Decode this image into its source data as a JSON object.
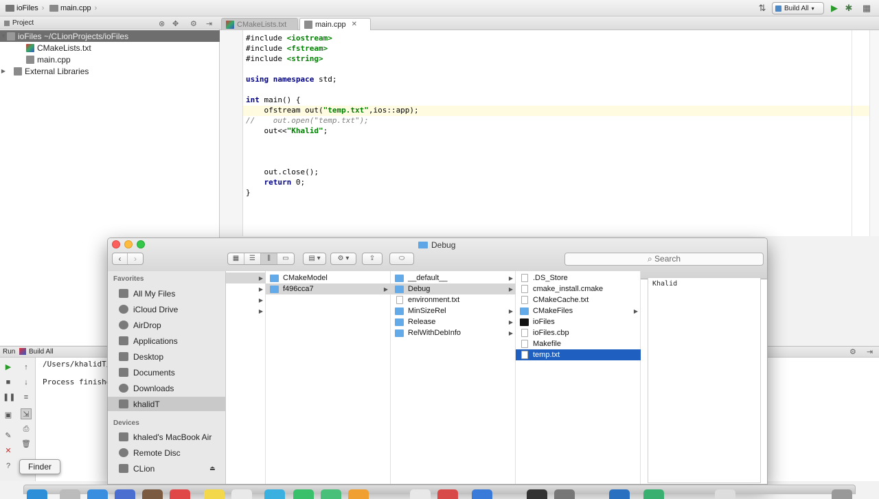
{
  "ide": {
    "breadcrumbs": [
      "ioFiles",
      "main.cpp"
    ],
    "build_config": "Build All",
    "project_panel_title": "Project",
    "tree": [
      {
        "label": "ioFiles  ~/CLionProjects/ioFiles",
        "level": 0,
        "selected": true
      },
      {
        "label": "CMakeLists.txt",
        "level": 1,
        "icon": "cmake-icon"
      },
      {
        "label": "main.cpp",
        "level": 1,
        "icon": "cpp-file-icon"
      },
      {
        "label": "External Libraries",
        "level": 0,
        "icon": "library-icon"
      }
    ],
    "tabs": [
      {
        "label": "CMakeLists.txt",
        "active": false
      },
      {
        "label": "main.cpp",
        "active": true
      }
    ],
    "code_lines": [
      "#include <iostream>",
      "#include <fstream>",
      "#include <string>",
      "",
      "using namespace std;",
      "",
      "int main() {",
      "    ofstream out(\"temp.txt\",ios::app);",
      "//    out.open(\"temp.txt\");",
      "    out<<\"Khalid\";",
      "",
      "",
      "",
      "    out.close();",
      "    return 0;",
      "}"
    ],
    "run": {
      "tab_label": "Run",
      "config_label": "Build All",
      "console": [
        "/Users/khalidT/",
        "Process finishe"
      ]
    }
  },
  "finder": {
    "title": "Debug",
    "search_placeholder": "Search",
    "sidebar": {
      "favorites_header": "Favorites",
      "favorites": [
        "All My Files",
        "iCloud Drive",
        "AirDrop",
        "Applications",
        "Desktop",
        "Documents",
        "Downloads",
        "khalidT"
      ],
      "selected_favorite": "khalidT",
      "devices_header": "Devices",
      "devices": [
        "khaled's MacBook Air",
        "Remote Disc",
        "CLion"
      ]
    },
    "columns": [
      [],
      [
        {
          "name": "CMakeModel",
          "kind": "folder"
        },
        {
          "name": "f496cca7",
          "kind": "folder",
          "selected": true
        }
      ],
      [
        {
          "name": "__default__",
          "kind": "folder"
        },
        {
          "name": "Debug",
          "kind": "folder",
          "selected": true
        },
        {
          "name": "environment.txt",
          "kind": "doc"
        },
        {
          "name": "MinSizeRel",
          "kind": "folder"
        },
        {
          "name": "Release",
          "kind": "folder"
        },
        {
          "name": "RelWithDebInfo",
          "kind": "folder"
        }
      ],
      [
        {
          "name": ".DS_Store",
          "kind": "doc"
        },
        {
          "name": "cmake_install.cmake",
          "kind": "doc"
        },
        {
          "name": "CMakeCache.txt",
          "kind": "doc"
        },
        {
          "name": "CMakeFiles",
          "kind": "folder"
        },
        {
          "name": "ioFiles",
          "kind": "exec"
        },
        {
          "name": "ioFiles.cbp",
          "kind": "doc"
        },
        {
          "name": "Makefile",
          "kind": "doc"
        },
        {
          "name": "temp.txt",
          "kind": "doc",
          "selected": true
        }
      ]
    ],
    "preview_text": "Khalid"
  },
  "tooltip": "Finder",
  "colors": {
    "selection_blue": "#1f5fbf",
    "folder_blue": "#63aae9",
    "keyword": "#000080",
    "string": "#008000",
    "traffic_close": "#fc605c",
    "traffic_minimize": "#fdbc40",
    "traffic_zoom": "#34c84a"
  }
}
